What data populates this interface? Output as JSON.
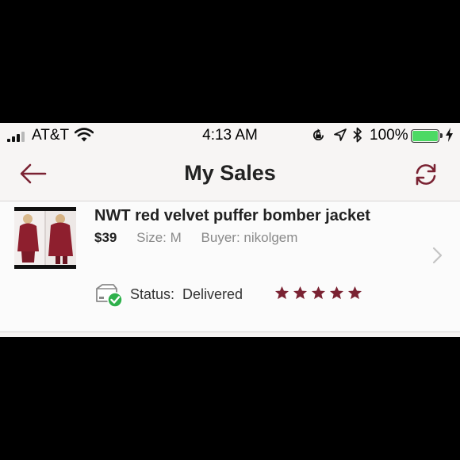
{
  "status_bar": {
    "carrier": "AT&T",
    "time": "4:13 AM",
    "battery_percent": "100%",
    "battery_level": 1.0,
    "battery_color": "#4cd964"
  },
  "nav": {
    "title": "My Sales",
    "back_icon": "back-arrow-icon",
    "refresh_icon": "refresh-icon"
  },
  "colors": {
    "accent": "#7a2232",
    "star": "#7a2232",
    "delivered_badge": "#2fb14c",
    "jacket": "#8e1f2e"
  },
  "sale": {
    "title": "NWT red velvet puffer bomber jacket",
    "price": "$39",
    "size_label": "Size: M",
    "buyer_label": "Buyer: nikolgem",
    "status_label": "Status:",
    "status_value": "Delivered",
    "rating": 5,
    "rating_max": 5
  }
}
